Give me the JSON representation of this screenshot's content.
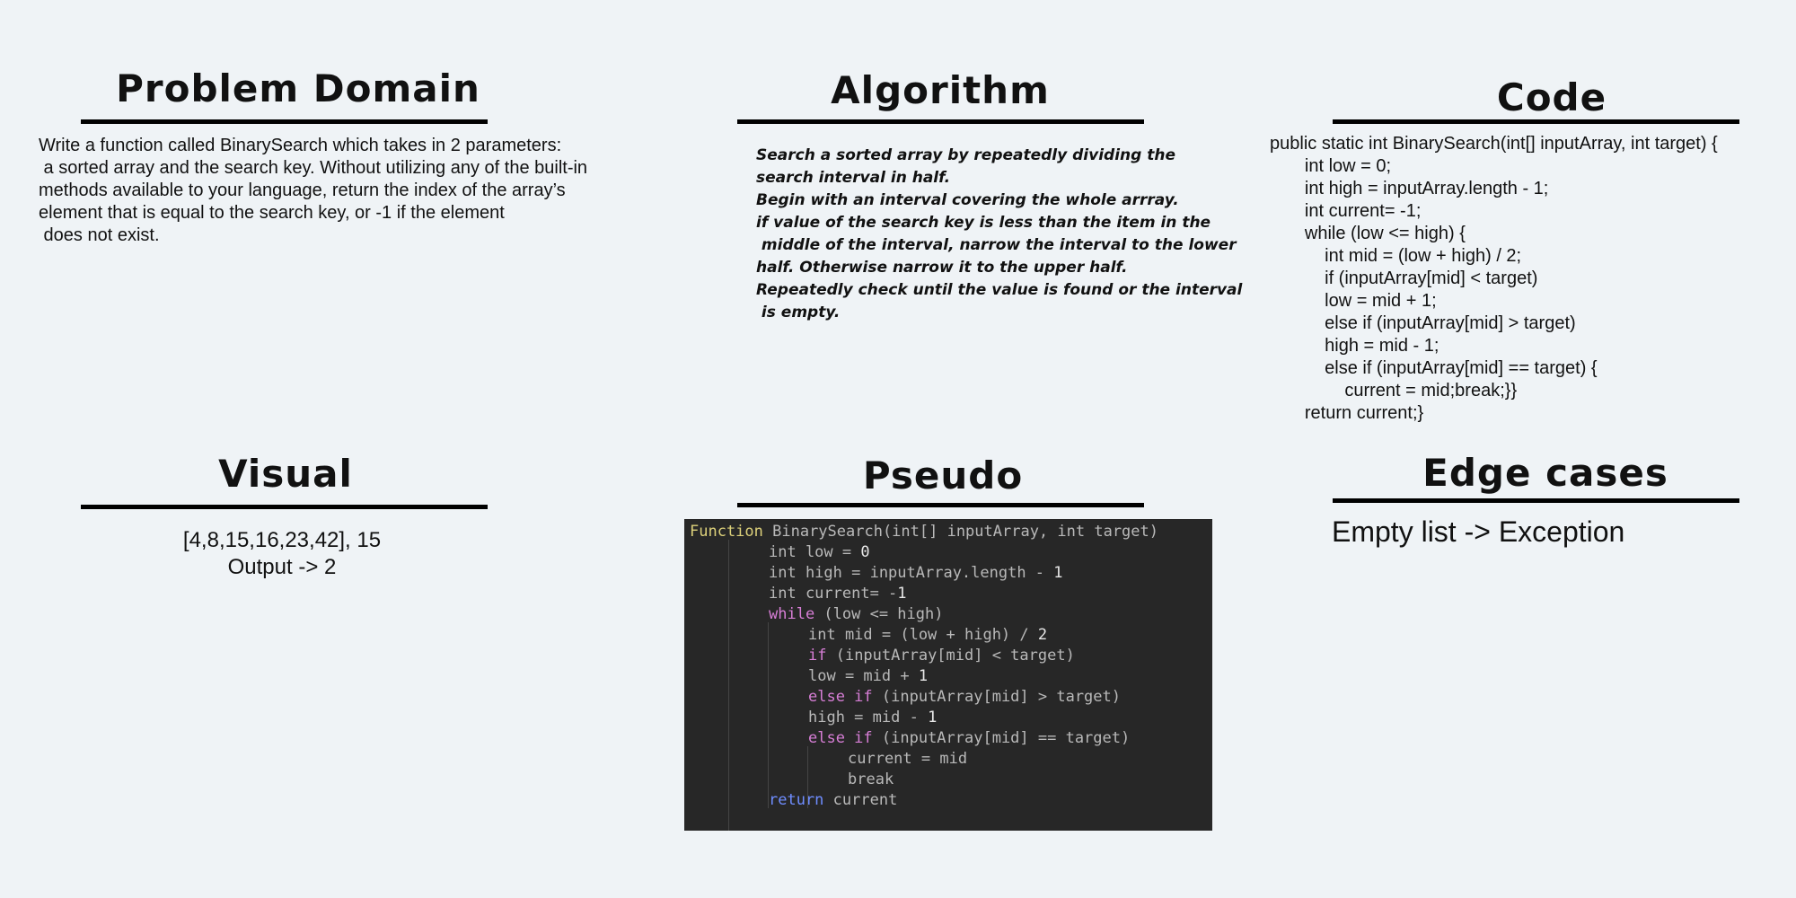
{
  "problem_domain": {
    "heading": "Problem Domain",
    "text": "Write a function called BinarySearch which takes in 2 parameters:\n a sorted array and the search key. Without utilizing any of the built-in\nmethods available to your language, return the index of the array’s\nelement that is equal to the search key, or -1 if the element\n does not exist."
  },
  "algorithm": {
    "heading": "Algorithm",
    "text": "Search a sorted array by repeatedly dividing the\nsearch interval in half.\nBegin with an interval covering the whole arrray.\nif value of the search key is less than the item in the\n middle of the interval, narrow the interval to the lower\nhalf. Otherwise narrow it to the upper half.\nRepeatedly check until the value is found or the interval\n is empty."
  },
  "code": {
    "heading": "Code",
    "text": "public static int BinarySearch(int[] inputArray, int target) {\n       int low = 0;\n       int high = inputArray.length - 1;\n       int current= -1;\n       while (low <= high) {\n           int mid = (low + high) / 2;\n           if (inputArray[mid] < target)\n           low = mid + 1;\n           else if (inputArray[mid] > target)\n           high = mid - 1;\n           else if (inputArray[mid] == target) {\n               current = mid;break;}}\n       return current;}"
  },
  "visual": {
    "heading": "Visual",
    "line1": "[4,8,15,16,23,42], 15",
    "line2": "Output -> 2"
  },
  "pseudo": {
    "heading": "Pseudo",
    "lines": {
      "l1_kw": "Function",
      "l1_rest": " BinarySearch(int[] inputArray, int target)",
      "l2_a": "int low = ",
      "l2_n": "0",
      "l3_a": "int high = inputArray.length - ",
      "l3_n": "1",
      "l4_a": "int current= -",
      "l4_n": "1",
      "l5_kw": "while",
      "l5_rest": " (low <= high)",
      "l6_a": "int mid = (low + high) / ",
      "l6_n": "2",
      "l7_kw": "if",
      "l7_rest": " (inputArray[mid] < target)",
      "l8_a": "low = mid + ",
      "l8_n": "1",
      "l9_kw": "else if",
      "l9_rest": " (inputArray[mid] > target)",
      "l10_a": "high = mid - ",
      "l10_n": "1",
      "l11_kw": "else if",
      "l11_rest": " (inputArray[mid] == target)",
      "l12": "current = mid",
      "l13": "break",
      "l14_kw": "return",
      "l14_rest": " current"
    }
  },
  "edge_cases": {
    "heading": "Edge cases",
    "text": "Empty list -> Exception"
  },
  "colors": {
    "background": "#eff3f6",
    "code_background": "#272727",
    "keyword_function": "#dcd07a",
    "keyword_control": "#d77ed6",
    "keyword_return": "#6f8dff"
  }
}
